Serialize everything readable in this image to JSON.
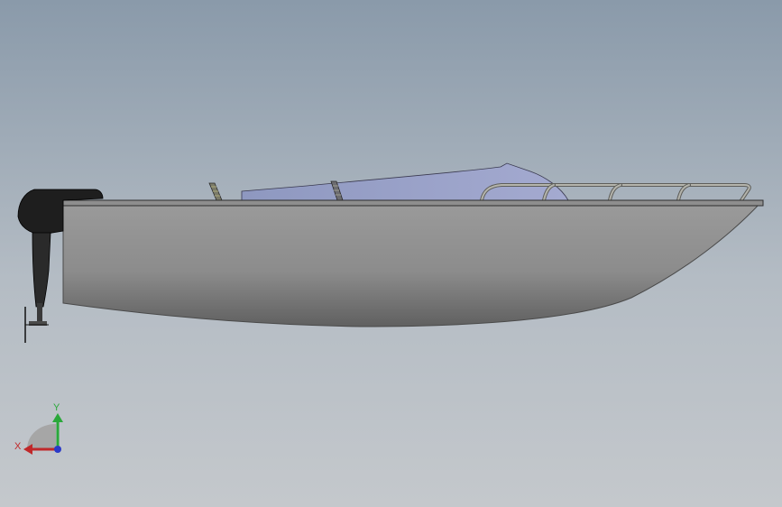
{
  "viewport": {
    "colors": {
      "background_top": "#8a9aaa",
      "background_bottom": "#c4c8cc",
      "hull": "#8c8c8c",
      "engine": "#1e1e1e",
      "canopy": "#9aa2c8",
      "rail": "#9a9a94"
    }
  },
  "model": {
    "name": "boat",
    "parts": [
      "hull",
      "deck",
      "outboard-motor",
      "canopy",
      "windshield-post-left",
      "windshield-post-right",
      "bow-railing"
    ]
  },
  "triad": {
    "y_label": "Y",
    "x_label": "X",
    "colors": {
      "x": "#c0282a",
      "y": "#2aa83a",
      "z": "#2a3ac8"
    }
  }
}
